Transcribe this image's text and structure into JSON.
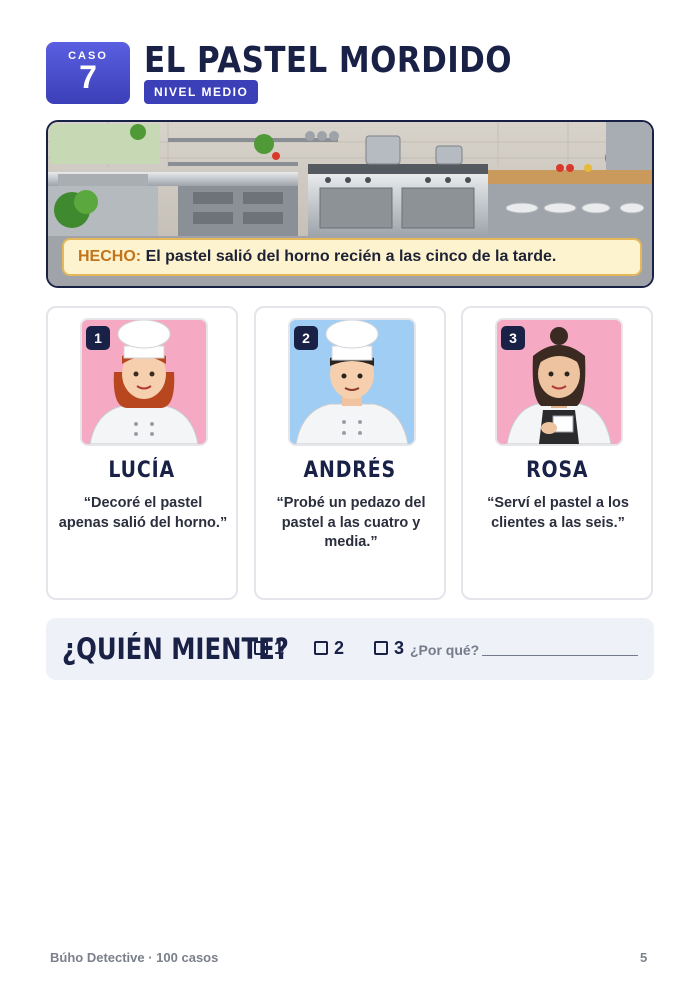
{
  "header": {
    "case_label": "CASO",
    "case_number": "7",
    "title": "EL PASTEL MORDIDO",
    "level": "NIVEL MEDIO"
  },
  "scene": {
    "image": "kitchen-illustration",
    "fact_label": "HECHO:",
    "fact_text": "El pastel salió del horno recién a las cinco de la tarde."
  },
  "suspects": [
    {
      "number": "1",
      "name": "LUCÍA",
      "quote": "“Decoré el pastel apenas salió del horno.”",
      "portrait_bg": "#f6a9c3",
      "role": "chef"
    },
    {
      "number": "2",
      "name": "ANDRÉS",
      "quote": "“Probé un pedazo del pastel a las cuatro y media.”",
      "portrait_bg": "#9fcdf3",
      "role": "chef"
    },
    {
      "number": "3",
      "name": "ROSA",
      "quote": "“Serví el pastel a los clientes a las seis.”",
      "portrait_bg": "#f6a9c3",
      "role": "waitress"
    }
  ],
  "question": {
    "text": "¿QUIÉN MIENTE?",
    "options": [
      "1",
      "2",
      "3"
    ],
    "why_label": "¿Por qué?"
  },
  "footer": {
    "left": "Búho Detective · 100 casos",
    "page": "5"
  },
  "colors": {
    "navy": "#1a2147",
    "accent": "#3b3fb8",
    "fact_label": "#c2741c",
    "fact_bg": "#fdf3cf"
  }
}
